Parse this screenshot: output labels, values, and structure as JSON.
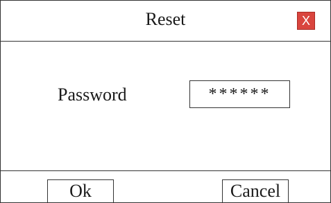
{
  "dialog": {
    "title": "Reset",
    "close_label": "X"
  },
  "form": {
    "password_label": "Password",
    "password_value": "******"
  },
  "footer": {
    "ok_label": "Ok",
    "cancel_label": "Cancel"
  },
  "colors": {
    "close_button": "#d9453e",
    "border": "#333333"
  }
}
